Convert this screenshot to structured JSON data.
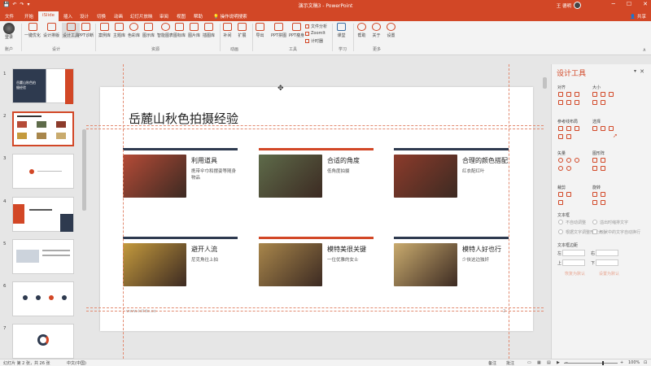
{
  "window": {
    "title": "演示文稿3 - PowerPoint",
    "user": "王 德明",
    "controls": [
      "─",
      "☐",
      "✕"
    ]
  },
  "menu": {
    "tabs": [
      "文件",
      "开始",
      "iSlide",
      "插入",
      "设计",
      "切换",
      "动画",
      "幻灯片放映",
      "审阅",
      "视图",
      "帮助",
      "操作说明搜索"
    ],
    "active_index": 2,
    "share": "共享"
  },
  "ribbon": {
    "account": {
      "label": "登录",
      "sub": "账户"
    },
    "design": [
      "一键优化",
      "设计排版",
      "设计工具",
      "PPT诊断"
    ],
    "design_group": "设计",
    "resources": [
      "案例库",
      "主题库",
      "色彩库",
      "图示库",
      "智能图表",
      "图标库",
      "图片库",
      "插图库"
    ],
    "resources_group": "资源",
    "animation": [
      "补间",
      "扩展"
    ],
    "animation_group": "动画",
    "tools": [
      "导出",
      "PPT拼图",
      "PPT瘦身"
    ],
    "tools_small": [
      "文件分析",
      "ZoomIt",
      "计时器"
    ],
    "tools_group": "工具",
    "learn": [
      "课堂"
    ],
    "learn_group": "学习",
    "more": [
      "帮助",
      "关于",
      "设置"
    ],
    "more_group": "更多"
  },
  "thumbnails": {
    "numbers": [
      "1",
      "2",
      "3",
      "4",
      "5",
      "6",
      "7"
    ],
    "selected_index": 1,
    "slide1_text": "岳麓山秋色拍摄经验"
  },
  "slide": {
    "title": "岳麓山秋色拍摄经验",
    "cards": [
      {
        "heading": "利用道具",
        "desc": "携带伞巾和摆姿等随身物品",
        "bar": "#2e3a4f",
        "photo": "#b54b37"
      },
      {
        "heading": "合适的角度",
        "desc": "低角度拍摄",
        "bar": "#d24726",
        "photo": "#5e6b4a"
      },
      {
        "heading": "合理的颜色搭配",
        "desc": "红衣配红叶",
        "bar": "#2e3a4f",
        "photo": "#8c3b2b"
      },
      {
        "heading": "避开人流",
        "desc": "尼克角往上拍",
        "bar": "#2e3a4f",
        "photo": "#c49a3d"
      },
      {
        "heading": "模特美很关键",
        "desc": "一位优雅的女士",
        "bar": "#d24726",
        "photo": "#a8864b"
      },
      {
        "heading": "模特人好也行",
        "desc": "少侠这边独奸",
        "bar": "#2e3a4f",
        "photo": "#c9ab6e"
      }
    ],
    "footer_url": "www.islide.cc",
    "page_number": "2"
  },
  "panel": {
    "title": "设计工具",
    "sections": {
      "align": "对齐",
      "size": "大小",
      "guides": "参考线布局",
      "select": "选择",
      "vector": "矢量",
      "shape_grid": "图形阵",
      "crop": "裁剪",
      "rotate": "旋转",
      "textbox": "文本框",
      "textbox_margin": "文本框边距"
    },
    "textbox_options": [
      "不自动调整",
      "溢出时缩排文字",
      "根据文字调整形状大小",
      "形状中的文字自动换行"
    ],
    "margin_fields": [
      "左",
      "右",
      "上",
      "下"
    ],
    "links": [
      "恢复为默认",
      "设置为默认"
    ]
  },
  "status": {
    "slide_info": "幻灯片 第 2 张，共 26 张",
    "language": "中文(中国)",
    "notes": "备注",
    "comments": "批注",
    "zoom": "100%"
  },
  "colors": {
    "accent": "#d24726",
    "navy": "#2e3a4f"
  }
}
